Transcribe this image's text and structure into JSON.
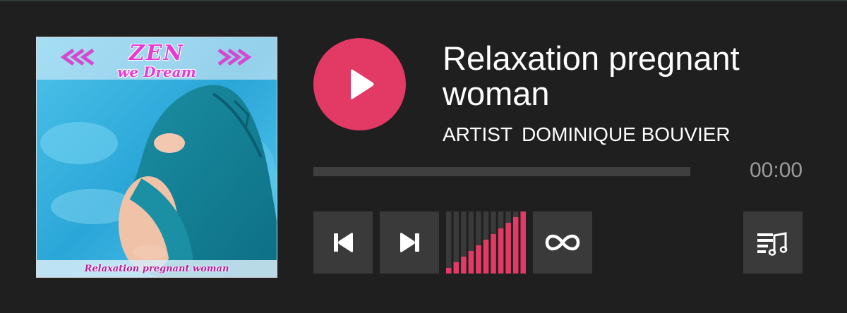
{
  "track": {
    "title": "Relaxation pregnant woman",
    "artist_label": "ARTIST",
    "artist_name": "DOMINIQUE BOUVIER"
  },
  "cover": {
    "logo_line1": "ZEN",
    "logo_line2": "we Dream",
    "caption": "Relaxation pregnant woman"
  },
  "playback": {
    "time": "00:00",
    "progress": 0,
    "state": "paused"
  },
  "volume": {
    "level": 1.0,
    "bars": 11
  },
  "controls": {
    "play_icon": "play-icon",
    "prev_icon": "skip-previous-icon",
    "next_icon": "skip-next-icon",
    "loop_icon": "infinity-loop-icon",
    "playlist_icon": "playlist-music-icon"
  },
  "colors": {
    "background": "#1f1f1f",
    "accent": "#e23a64",
    "button": "#3a3a3a",
    "track": "#3f3f3f",
    "time": "#9b9b9b",
    "text": "#ffffff"
  }
}
